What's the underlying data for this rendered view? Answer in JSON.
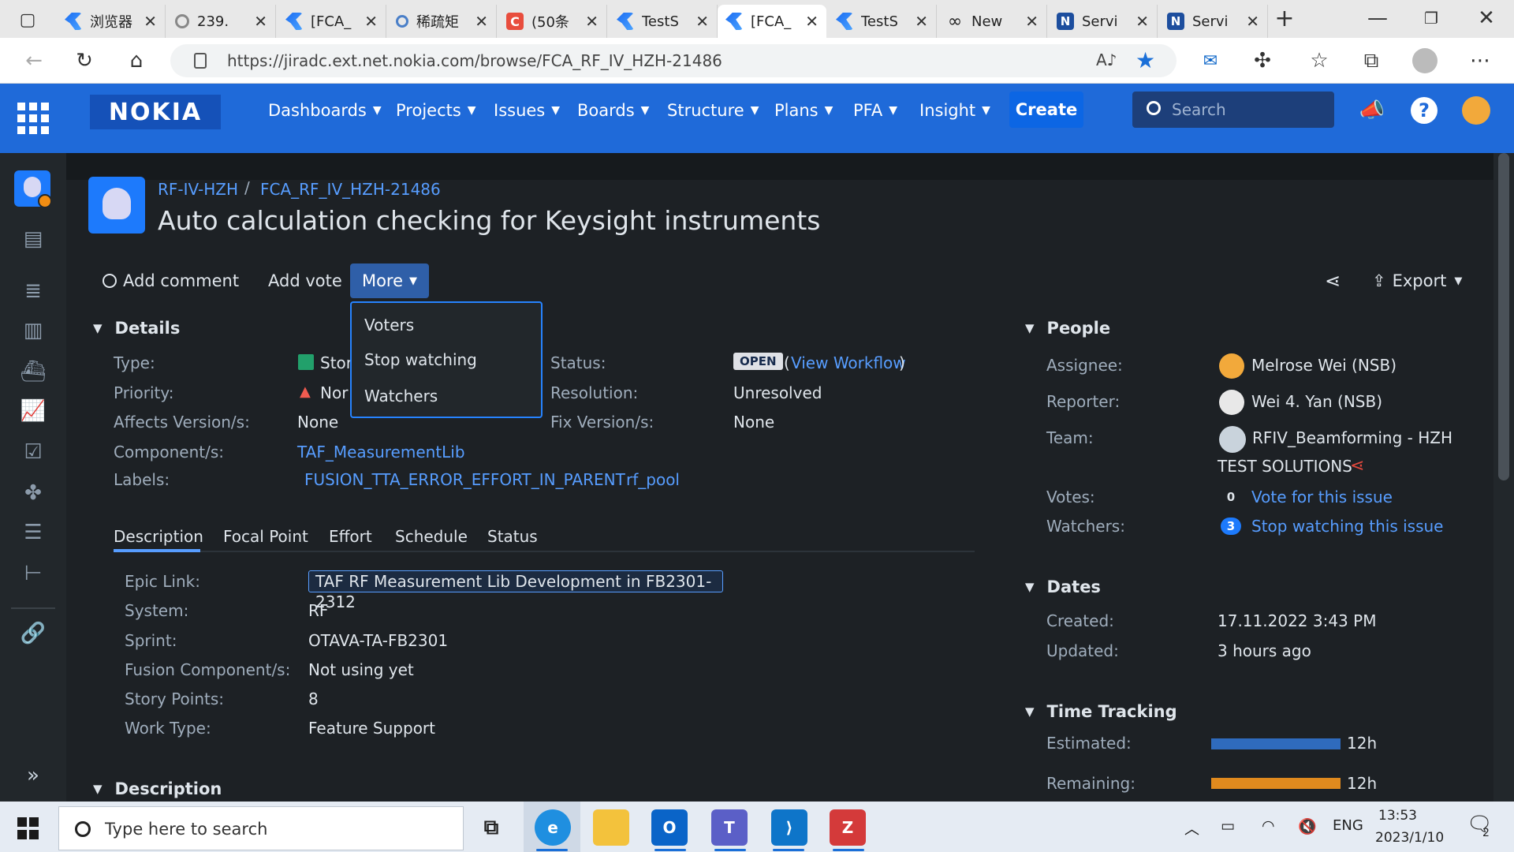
{
  "browser": {
    "tabs": [
      {
        "title": "浏览器",
        "icon": "jira-icon"
      },
      {
        "title": "239.",
        "icon": "loop-icon"
      },
      {
        "title": "[FCA_",
        "icon": "jira-icon"
      },
      {
        "title": "稀疏矩",
        "icon": "search-icon"
      },
      {
        "title": "(50条",
        "icon": "c-icon"
      },
      {
        "title": "TestS",
        "icon": "jira-icon"
      },
      {
        "title": "[FCA_",
        "icon": "jira-icon"
      },
      {
        "title": "TestS",
        "icon": "jira-icon"
      },
      {
        "title": "New",
        "icon": "infinity-icon"
      },
      {
        "title": "Servi",
        "icon": "n-icon"
      },
      {
        "title": "Servi",
        "icon": "n-icon"
      }
    ],
    "new_tab": "+",
    "url": "https://jiradc.ext.net.nokia.com/browse/FCA_RF_IV_HZH-21486"
  },
  "header": {
    "logo": "NOKIA",
    "menus": [
      "Dashboards",
      "Projects",
      "Issues",
      "Boards",
      "Structure",
      "Plans",
      "PFA",
      "Insight"
    ],
    "create": "Create",
    "search_placeholder": "Search"
  },
  "issue": {
    "project": "RF-IV-HZH",
    "separator": "/",
    "key": "FCA_RF_IV_HZH-21486",
    "title": "Auto calculation checking for Keysight instruments"
  },
  "toolbar": {
    "add_comment": "Add comment",
    "add_vote": "Add vote",
    "more": "More",
    "export": "Export"
  },
  "more_menu": [
    "Voters",
    "Stop watching",
    "Watchers"
  ],
  "details": {
    "header": "Details",
    "type_label": "Type:",
    "type_value": "Stor",
    "priority_label": "Priority:",
    "priority_value": "Nor",
    "affects_label": "Affects Version/s:",
    "affects_value": "None",
    "component_label": "Component/s:",
    "component_value": "TAF_MeasurementLib",
    "labels_label": "Labels:",
    "labels": [
      "FUSION_TTA_ERROR_EFFORT_IN_PARENT",
      "rf_pool"
    ],
    "status_label": "Status:",
    "status_value": "OPEN",
    "status_link": "View Workflow",
    "status_paren_open": "(",
    "status_paren_close": ")",
    "resolution_label": "Resolution:",
    "resolution_value": "Unresolved",
    "fix_label": "Fix Version/s:",
    "fix_value": "None"
  },
  "tabs": [
    "Description",
    "Focal Point",
    "Effort",
    "Schedule",
    "Status"
  ],
  "description_fields": [
    {
      "label": "Epic Link:",
      "value": "TAF RF Measurement Lib Development in FB2301-2312"
    },
    {
      "label": "System:",
      "value": "RF"
    },
    {
      "label": "Sprint:",
      "value": "OTAVA-TA-FB2301"
    },
    {
      "label": "Fusion Component/s:",
      "value": "Not using yet"
    },
    {
      "label": "Story Points:",
      "value": "8"
    },
    {
      "label": "Work Type:",
      "value": "Feature Support"
    }
  ],
  "description_header": "Description",
  "people": {
    "header": "People",
    "assignee_label": "Assignee:",
    "assignee": "Melrose Wei (NSB)",
    "reporter_label": "Reporter:",
    "reporter": "Wei 4. Yan (NSB)",
    "team_label": "Team:",
    "team_line1": "RFIV_Beamforming - HZH",
    "team_line2": "TEST SOLUTIONS",
    "votes_label": "Votes:",
    "votes_count": "0",
    "votes_link": "Vote for this issue",
    "watchers_label": "Watchers:",
    "watchers_count": "3",
    "watchers_link": "Stop watching this issue"
  },
  "dates": {
    "header": "Dates",
    "created_label": "Created:",
    "created": "17.11.2022 3:43 PM",
    "updated_label": "Updated:",
    "updated": "3 hours ago"
  },
  "time_tracking": {
    "header": "Time Tracking",
    "estimated_label": "Estimated:",
    "estimated": "12h",
    "estimated_fill": 1.0,
    "remaining_label": "Remaining:",
    "remaining": "12h",
    "remaining_fill": 1.0
  },
  "taskbar": {
    "search_placeholder": "Type here to search",
    "lang": "ENG",
    "time": "13:53",
    "date": "2023/1/10",
    "notification_count": "2"
  },
  "colors": {
    "header_blue": "#1f6ad9",
    "link": "#579dff",
    "estimated_bar": "#2f6bbd",
    "remaining_bar": "#e08a1e"
  }
}
